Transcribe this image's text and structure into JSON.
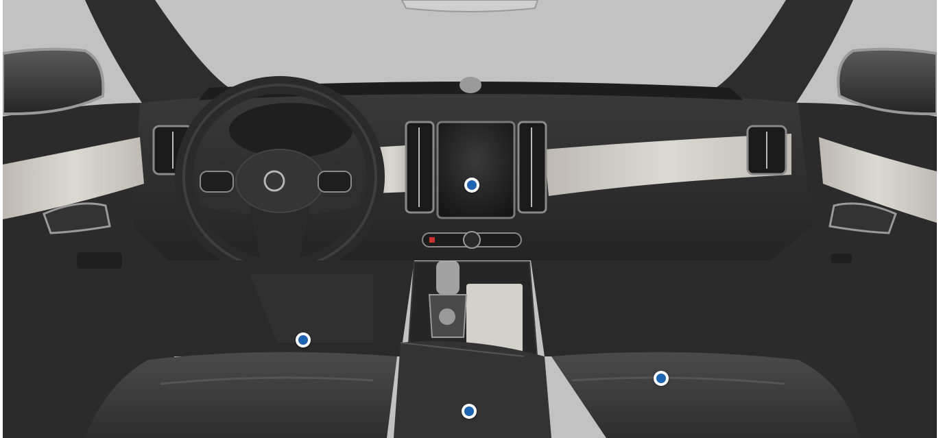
{
  "scene": {
    "icon": "car-interior-dashboard",
    "colors": {
      "sky": "#c2c2c2",
      "trim": "#2a2a2a",
      "upholstery": "#3a3a3a",
      "inlay": "#d4d1cb",
      "hotspot": "#1f64b4"
    }
  },
  "hotspots": [
    {
      "icon": "hotspot-marker",
      "area": "center-touchscreen"
    },
    {
      "icon": "hotspot-marker",
      "area": "driver-footwell"
    },
    {
      "icon": "hotspot-marker",
      "area": "center-armrest"
    },
    {
      "icon": "hotspot-marker",
      "area": "passenger-seat"
    }
  ]
}
